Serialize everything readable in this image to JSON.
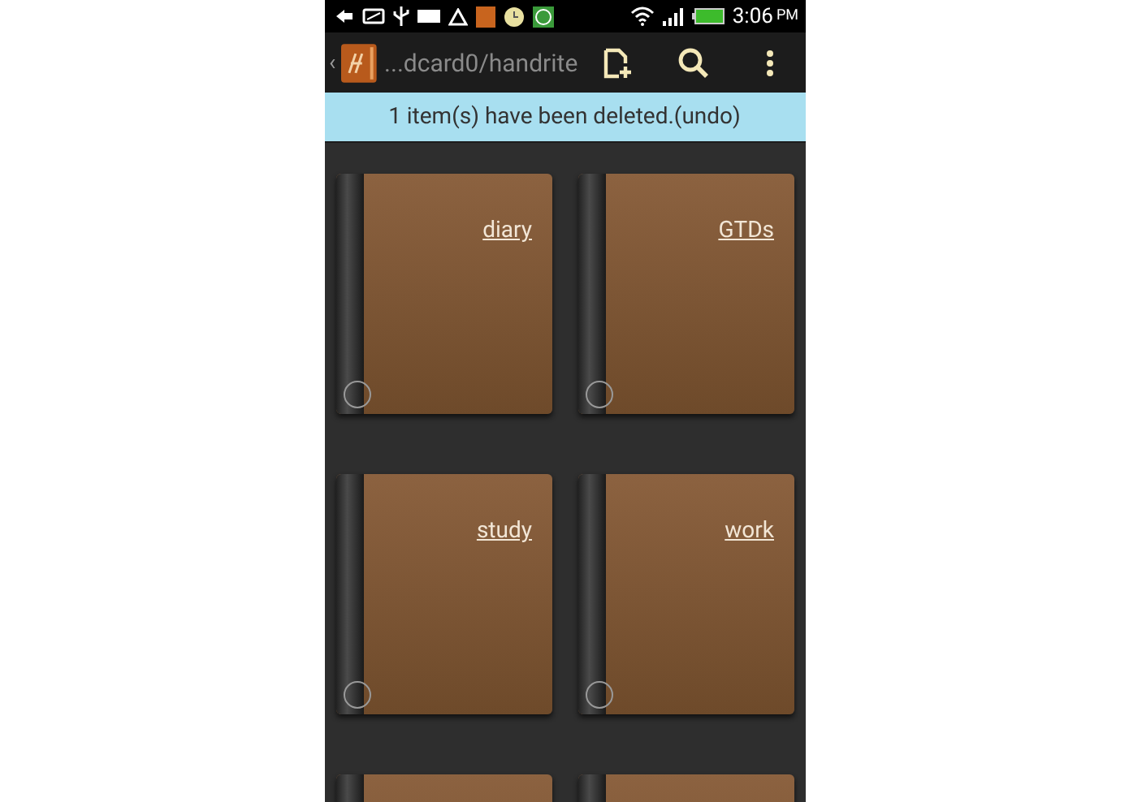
{
  "status_bar": {
    "time": "3:06",
    "ampm": "PM"
  },
  "toolbar": {
    "back": "‹",
    "path": "...dcard0/handrite"
  },
  "snackbar": {
    "message": "1 item(s) have been deleted.(undo)"
  },
  "notebooks": [
    {
      "kind": "titled",
      "title": "diary"
    },
    {
      "kind": "titled",
      "title": "GTDs"
    },
    {
      "kind": "titled",
      "title": "study"
    },
    {
      "kind": "titled",
      "title": "work"
    },
    {
      "kind": "untitled"
    },
    {
      "kind": "untitled"
    }
  ]
}
